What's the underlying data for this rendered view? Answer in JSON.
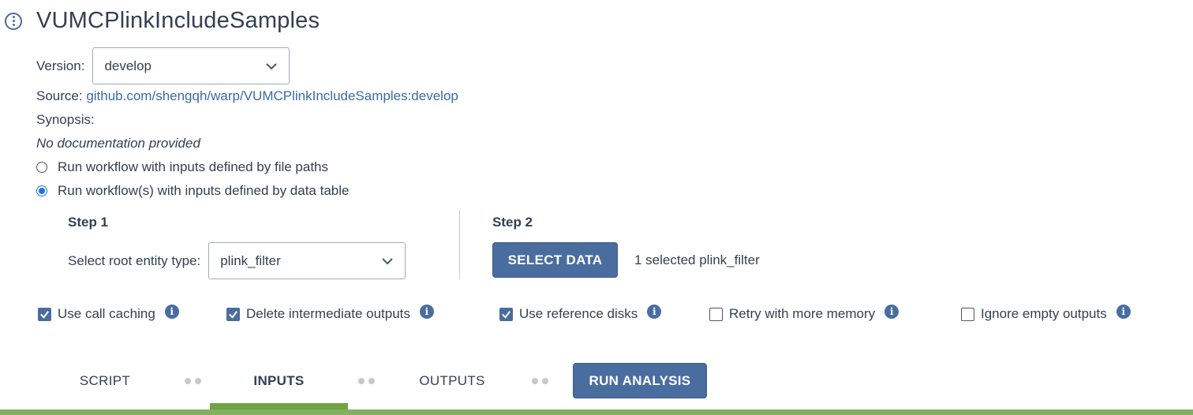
{
  "header": {
    "title": "VUMCPlinkIncludeSamples",
    "icon": "more-vertical-icon"
  },
  "version": {
    "label": "Version:",
    "value": "develop"
  },
  "source": {
    "label": "Source: ",
    "link": "github.com/shengqh/warp/VUMCPlinkIncludeSamples:develop"
  },
  "synopsis": {
    "label": "Synopsis:",
    "text": "No documentation provided"
  },
  "run_mode": {
    "options": [
      {
        "label": "Run workflow with inputs defined by file paths",
        "selected": false
      },
      {
        "label": "Run workflow(s) with inputs defined by data table",
        "selected": true
      }
    ]
  },
  "step1": {
    "title": "Step 1",
    "label": "Select root entity type:",
    "value": "plink_filter"
  },
  "step2": {
    "title": "Step 2",
    "button": "SELECT DATA",
    "selection_text": "1 selected plink_filter"
  },
  "options": [
    {
      "label": "Use call caching",
      "checked": true
    },
    {
      "label": "Delete intermediate outputs",
      "checked": true
    },
    {
      "label": "Use reference disks",
      "checked": true
    },
    {
      "label": "Retry with more memory",
      "checked": false
    },
    {
      "label": "Ignore empty outputs",
      "checked": false
    }
  ],
  "tabs": {
    "script": "SCRIPT",
    "inputs": "INPUTS",
    "outputs": "OUTPUTS",
    "run": "RUN ANALYSIS",
    "active": "INPUTS"
  },
  "colors": {
    "accent": "#4a6da0",
    "active_tab": "#6fa343",
    "radio": "#1a73e8"
  }
}
